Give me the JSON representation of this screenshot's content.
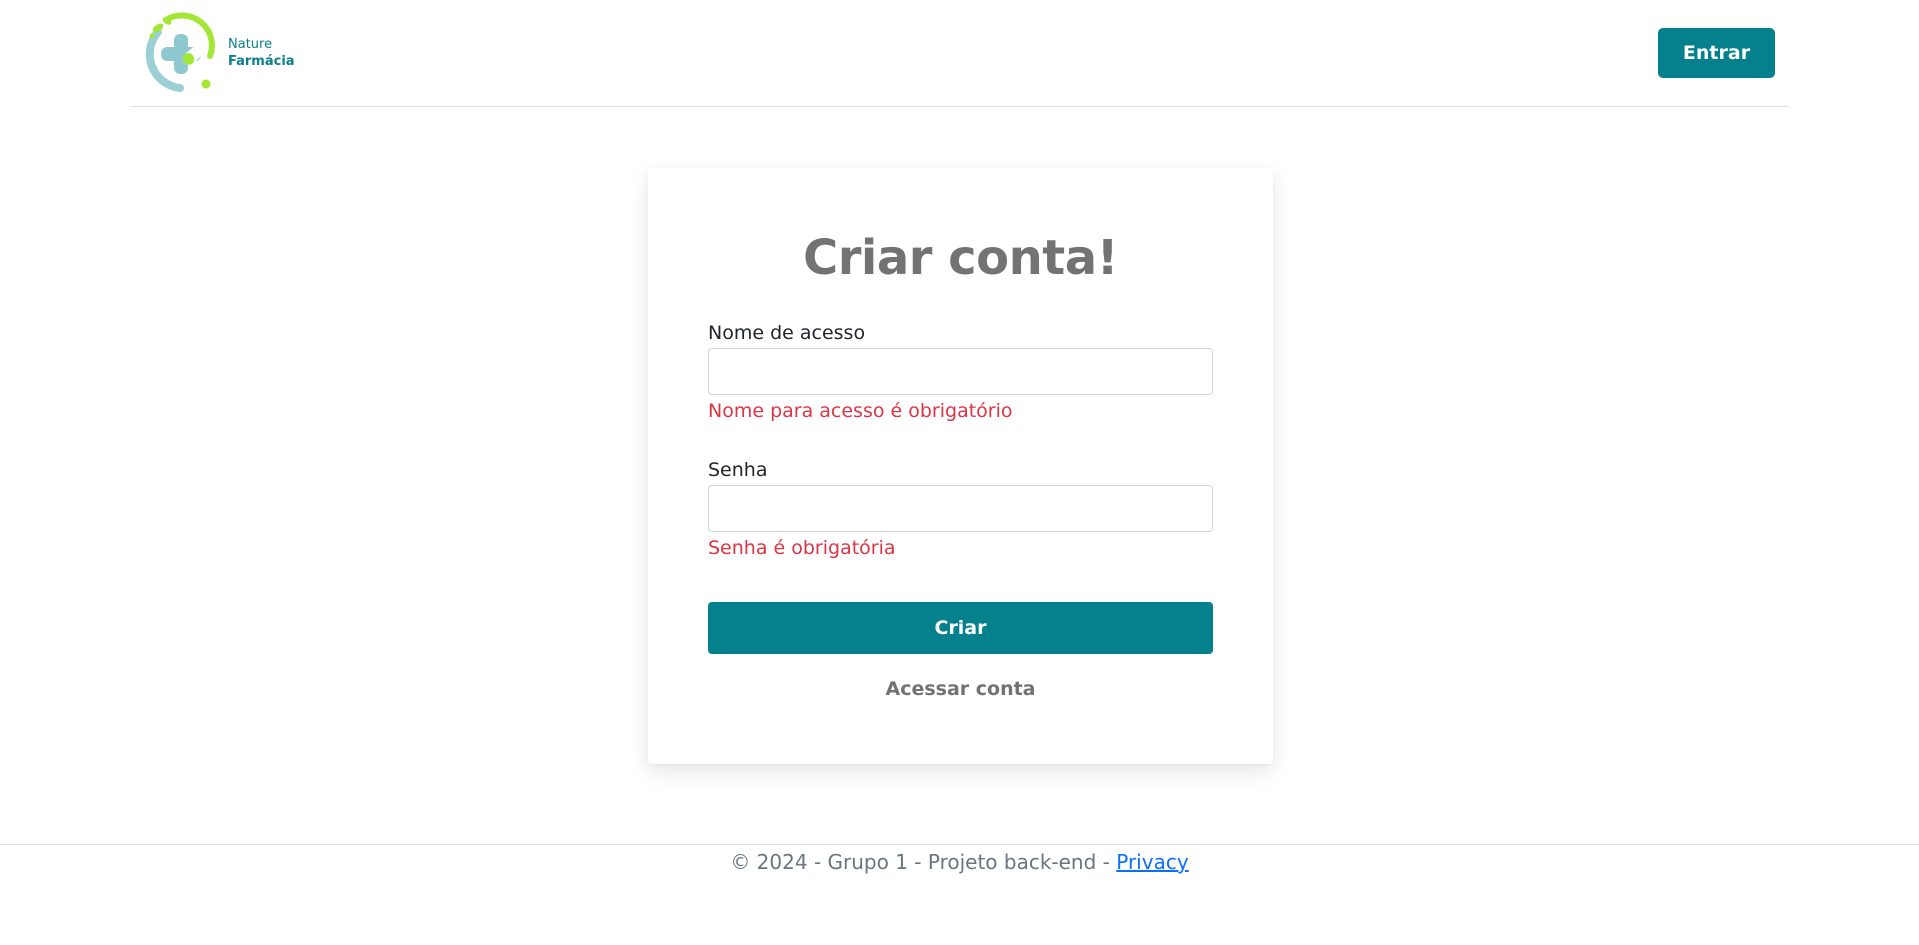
{
  "header": {
    "logo_line1": "Nature",
    "logo_line2": "Farmácia",
    "login_button": "Entrar"
  },
  "form": {
    "title": "Criar conta!",
    "username_label": "Nome de acesso",
    "username_value": "",
    "username_error": "Nome para acesso é obrigatório",
    "password_label": "Senha",
    "password_value": "",
    "password_error": "Senha é obrigatória",
    "submit_label": "Criar",
    "login_link": "Acessar conta"
  },
  "footer": {
    "text": "© 2024 - Grupo 1 - Projeto back-end - ",
    "privacy_link": "Privacy"
  },
  "colors": {
    "primary": "#05818d",
    "error": "#dc3545",
    "title_gray": "#737373",
    "logo_green": "#a3e635",
    "logo_teal": "#8fc9cf",
    "link_blue": "#0d6efd"
  },
  "icons": {
    "logo": "pharmacy-cross-leaf-icon"
  }
}
